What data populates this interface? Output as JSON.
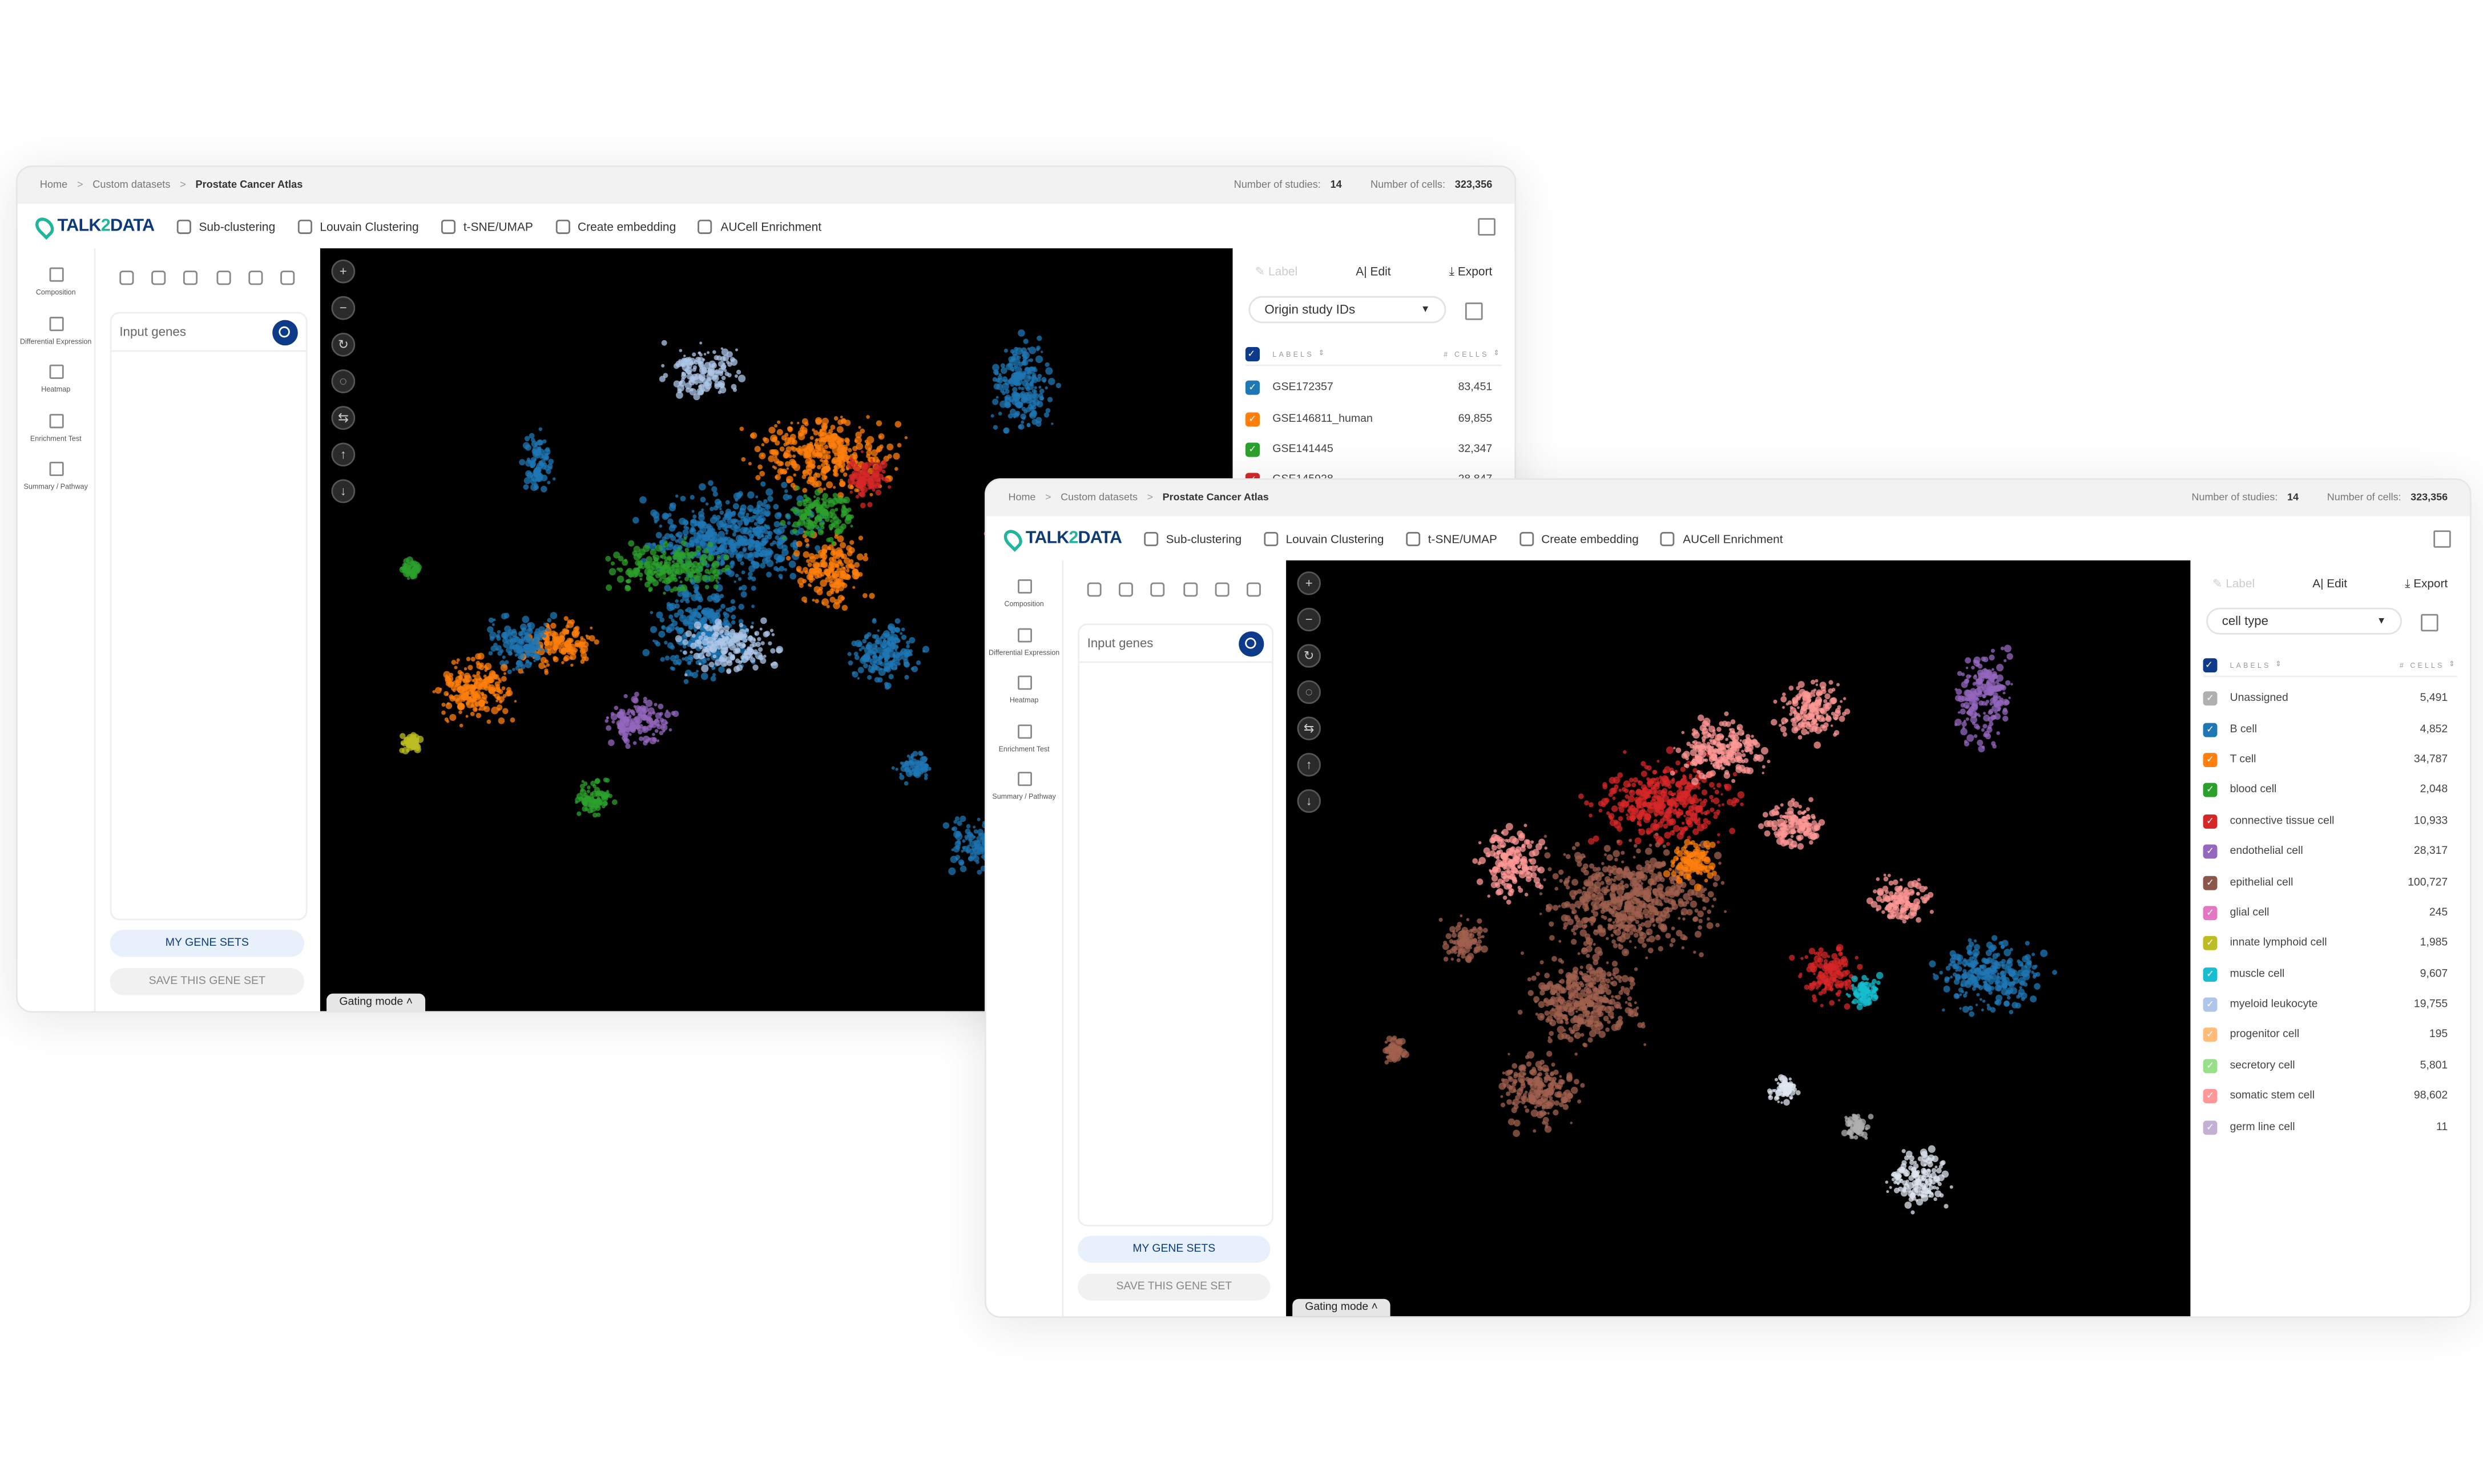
{
  "app": {
    "logo_text": "TALK2DATA",
    "breadcrumb": [
      "Home",
      "Custom datasets",
      "Prostate Cancer Atlas"
    ],
    "stats": [
      {
        "label": "Number of studies:",
        "value": "14"
      },
      {
        "label": "Number of cells:",
        "value": "323,356"
      }
    ],
    "toolbar": [
      {
        "label": "Sub-clustering",
        "icon": "sub-clustering-icon"
      },
      {
        "label": "Louvain Clustering",
        "icon": "louvain-icon"
      },
      {
        "label": "t-SNE/UMAP",
        "icon": "tsne-umap-icon"
      },
      {
        "label": "Create embedding",
        "icon": "embedding-icon"
      },
      {
        "label": "AUCell Enrichment",
        "icon": "aucell-icon"
      }
    ],
    "nav": [
      {
        "label": "Composition",
        "icon": "composition-icon"
      },
      {
        "label": "Differential Expression",
        "icon": "differential-expression-icon"
      },
      {
        "label": "Heatmap",
        "icon": "heatmap-icon"
      },
      {
        "label": "Enrichment Test",
        "icon": "enrichment-icon"
      },
      {
        "label": "Summary / Pathway",
        "icon": "summary-icon"
      }
    ],
    "chart_icons": [
      "violin-plot-icon",
      "bar-plot-icon",
      "dot-matrix-icon",
      "pie-icon",
      "lollipop-icon",
      "stacked-bar-icon"
    ],
    "gene_placeholder": "Input genes",
    "my_gene_sets": "MY GENE SETS",
    "save_gene_set": "SAVE THIS GENE SET",
    "gating_mode": "Gating mode",
    "actions": {
      "label": "Label",
      "edit": "Edit",
      "export": "Export"
    },
    "labels_header": "LABELS",
    "cells_header": "# CELLS",
    "canvas_controls": [
      "zoom-in-icon",
      "zoom-out-icon",
      "reset-icon",
      "lasso-icon",
      "slider-icon",
      "upload-icon",
      "download-icon"
    ]
  },
  "windows": [
    {
      "dropdown": "Origin study IDs",
      "rows": [
        {
          "label": "GSE172357",
          "value": "83,451",
          "color": "#1f77b4"
        },
        {
          "label": "GSE146811_human",
          "value": "69,855",
          "color": "#ff7f0e"
        },
        {
          "label": "GSE141445",
          "value": "32,347",
          "color": "#2ca02c"
        },
        {
          "label": "GSE145928",
          "value": "28,847",
          "color": "#d62728"
        }
      ]
    },
    {
      "dropdown": "cell type",
      "rows": [
        {
          "label": "Unassigned",
          "value": "5,491",
          "color": "#b0b0b0"
        },
        {
          "label": "B cell",
          "value": "4,852",
          "color": "#1f77b4"
        },
        {
          "label": "T cell",
          "value": "34,787",
          "color": "#ff7f0e"
        },
        {
          "label": "blood cell",
          "value": "2,048",
          "color": "#2ca02c"
        },
        {
          "label": "connective tissue cell",
          "value": "10,933",
          "color": "#d62728"
        },
        {
          "label": "endothelial cell",
          "value": "28,317",
          "color": "#9467bd"
        },
        {
          "label": "epithelial cell",
          "value": "100,727",
          "color": "#8c564b"
        },
        {
          "label": "glial cell",
          "value": "245",
          "color": "#e377c2"
        },
        {
          "label": "innate lymphoid cell",
          "value": "1,985",
          "color": "#bcbd22"
        },
        {
          "label": "muscle cell",
          "value": "9,607",
          "color": "#17becf"
        },
        {
          "label": "myeloid leukocyte",
          "value": "19,755",
          "color": "#aec7e8"
        },
        {
          "label": "progenitor cell",
          "value": "195",
          "color": "#ffbb78"
        },
        {
          "label": "secretory cell",
          "value": "5,801",
          "color": "#98df8a"
        },
        {
          "label": "somatic stem cell",
          "value": "98,602",
          "color": "#ff9896"
        },
        {
          "label": "germ line cell",
          "value": "11",
          "color": "#c5b0d5"
        }
      ]
    }
  ],
  "colors": {
    "accent": "#0d3b8a",
    "logo_teal": "#21b59b",
    "header_bg": "#f2f2f3",
    "canvas_bg": "#000000"
  }
}
